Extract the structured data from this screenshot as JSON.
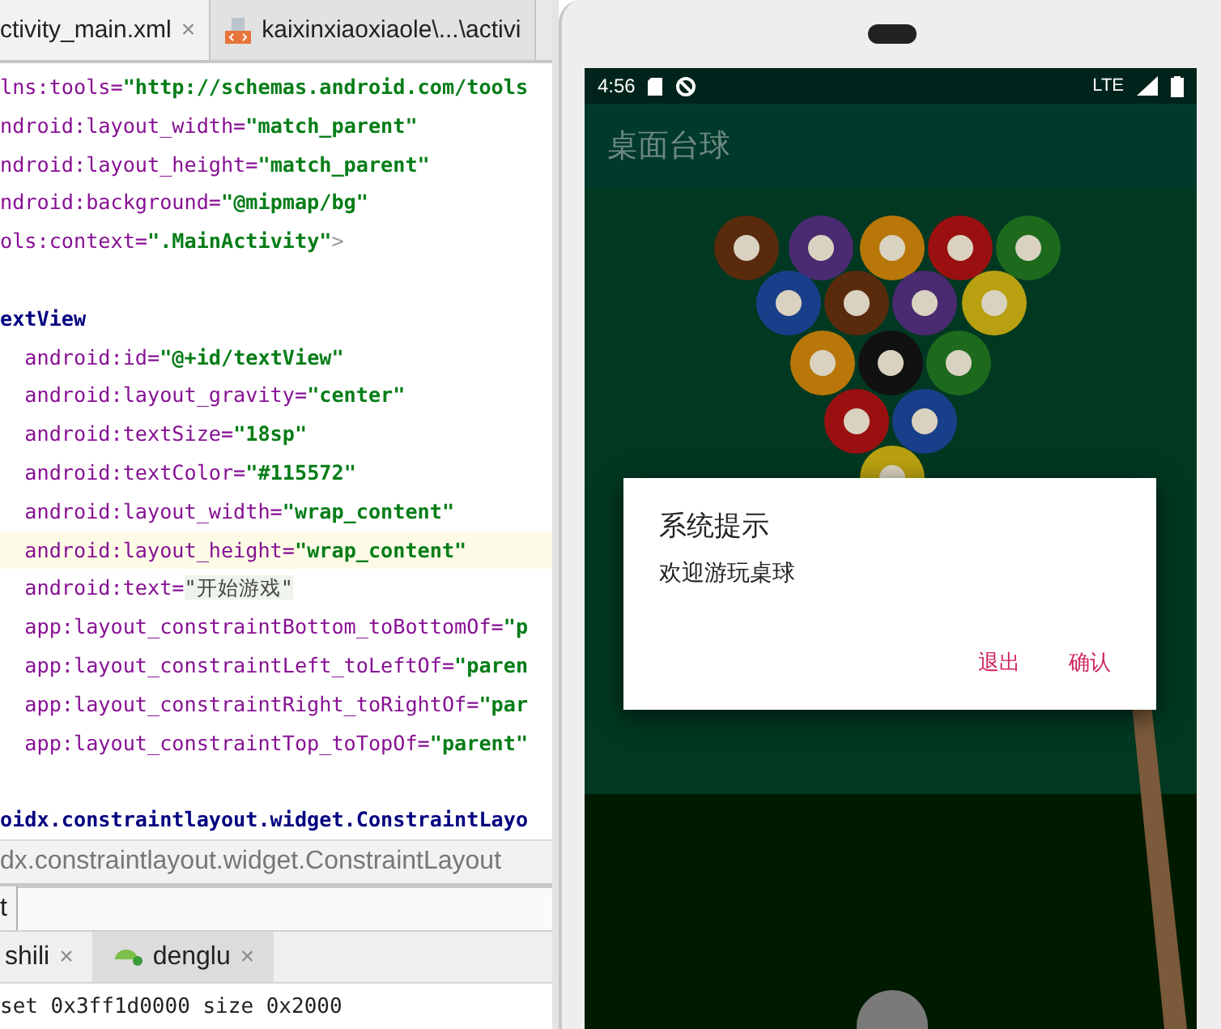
{
  "editor_tabs": [
    {
      "label": "ctivity_main.xml",
      "close": "×",
      "kind": "plain",
      "selected": true
    },
    {
      "label": "kaixinxiaoxiaole\\...\\activi",
      "kind": "xml-file",
      "selected": false
    }
  ],
  "code_lines": [
    {
      "kind": "code",
      "current": false,
      "segments": [
        {
          "kind": "name",
          "text": "lns:tools="
        },
        {
          "kind": "value",
          "text": "\"http://schemas.android.com/tools"
        }
      ]
    },
    {
      "kind": "code",
      "current": false,
      "segments": [
        {
          "kind": "name",
          "text": "ndroid:layout_width="
        },
        {
          "kind": "value",
          "text": "\"match_parent\""
        }
      ]
    },
    {
      "kind": "code",
      "current": false,
      "segments": [
        {
          "kind": "name",
          "text": "ndroid:layout_height="
        },
        {
          "kind": "value",
          "text": "\"match_parent\""
        }
      ]
    },
    {
      "kind": "code",
      "current": false,
      "segments": [
        {
          "kind": "name",
          "text": "ndroid:background="
        },
        {
          "kind": "value",
          "text": "\"@mipmap/bg\""
        }
      ]
    },
    {
      "kind": "code",
      "current": false,
      "segments": [
        {
          "kind": "name",
          "text": "ols:context="
        },
        {
          "kind": "value",
          "text": "\".MainActivity\""
        },
        {
          "kind": "punct",
          "text": ">"
        }
      ]
    },
    {
      "kind": "blank",
      "current": false
    },
    {
      "kind": "code",
      "current": false,
      "segments": [
        {
          "kind": "tag",
          "text": "extView"
        }
      ]
    },
    {
      "kind": "code",
      "current": false,
      "segments": [
        {
          "kind": "name",
          "text": "  android:id="
        },
        {
          "kind": "value",
          "text": "\"@+id/textView\""
        }
      ]
    },
    {
      "kind": "code",
      "current": false,
      "segments": [
        {
          "kind": "name",
          "text": "  android:layout_gravity="
        },
        {
          "kind": "value",
          "text": "\"center\""
        }
      ]
    },
    {
      "kind": "code",
      "current": false,
      "segments": [
        {
          "kind": "name",
          "text": "  android:textSize="
        },
        {
          "kind": "value",
          "text": "\"18sp\""
        }
      ]
    },
    {
      "kind": "code",
      "current": false,
      "segments": [
        {
          "kind": "name",
          "text": "  android:textColor="
        },
        {
          "kind": "value",
          "text": "\"#115572\""
        }
      ]
    },
    {
      "kind": "code",
      "current": false,
      "segments": [
        {
          "kind": "name",
          "text": "  android:layout_width="
        },
        {
          "kind": "value",
          "text": "\"wrap_content\""
        }
      ]
    },
    {
      "kind": "code",
      "current": true,
      "segments": [
        {
          "kind": "name",
          "text": "  android:layout_height="
        },
        {
          "kind": "value",
          "text": "\"wrap_content\""
        }
      ]
    },
    {
      "kind": "code",
      "current": false,
      "segments": [
        {
          "kind": "name",
          "text": "  android:text="
        },
        {
          "kind": "literal",
          "text": "\"开始游戏\""
        }
      ]
    },
    {
      "kind": "code",
      "current": false,
      "segments": [
        {
          "kind": "name",
          "text": "  app:layout_constraintBottom_toBottomOf="
        },
        {
          "kind": "value",
          "text": "\"p"
        }
      ]
    },
    {
      "kind": "code",
      "current": false,
      "segments": [
        {
          "kind": "name",
          "text": "  app:layout_constraintLeft_toLeftOf="
        },
        {
          "kind": "value",
          "text": "\"paren"
        }
      ]
    },
    {
      "kind": "code",
      "current": false,
      "segments": [
        {
          "kind": "name",
          "text": "  app:layout_constraintRight_toRightOf="
        },
        {
          "kind": "value",
          "text": "\"par"
        }
      ]
    },
    {
      "kind": "code",
      "current": false,
      "segments": [
        {
          "kind": "name",
          "text": "  app:layout_constraintTop_toTopOf="
        },
        {
          "kind": "value",
          "text": "\"parent\""
        }
      ]
    },
    {
      "kind": "blank",
      "current": false
    },
    {
      "kind": "code",
      "current": false,
      "segments": [
        {
          "kind": "tag",
          "text": "oidx.constraintlayout.widget.ConstraintLayo"
        }
      ]
    }
  ],
  "breadcrumb": "dx.constraintlayout.widget.ConstraintLayout",
  "run_panel": {
    "tab_label": "t",
    "tabs": [
      {
        "label": "shili",
        "close": "×",
        "kind": "plain",
        "selected": false
      },
      {
        "label": "denglu",
        "close": "×",
        "kind": "android-app",
        "selected": true
      }
    ],
    "log_line": "set 0x3ff1d0000 size 0x2000"
  },
  "phone": {
    "status_bar": {
      "time": "4:56",
      "network": "LTE"
    },
    "app_bar_title": "桌面台球",
    "dialog": {
      "title": "系统提示",
      "message": "欢迎游玩桌球",
      "buttons": [
        "退出",
        "确认"
      ]
    }
  }
}
